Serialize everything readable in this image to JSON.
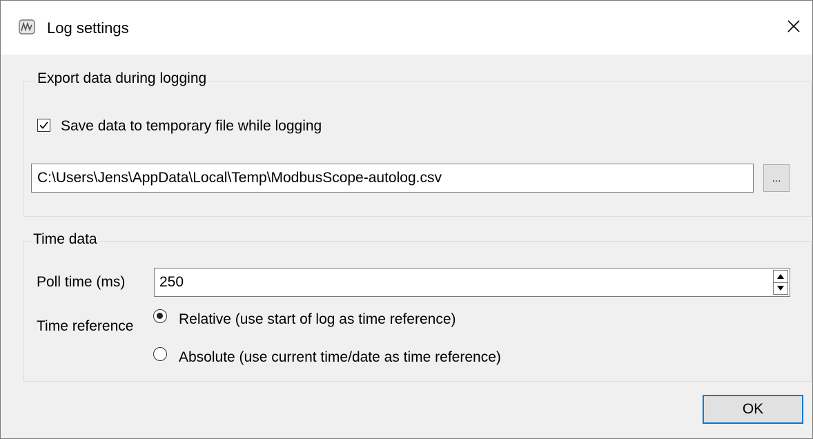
{
  "window": {
    "title": "Log settings",
    "icon": "modbusscope-app-icon",
    "close_icon": "close-icon"
  },
  "export_group": {
    "legend": "Export data during logging",
    "save_checkbox": {
      "label": "Save data to temporary file while logging",
      "checked": true
    },
    "file_path": "C:\\Users\\Jens\\AppData\\Local\\Temp\\ModbusScope-autolog.csv",
    "browse_label": "..."
  },
  "time_group": {
    "legend": "Time data",
    "poll_time_label": "Poll time (ms)",
    "poll_time_value": "250",
    "time_reference_label": "Time reference",
    "options": [
      {
        "label": "Relative (use start of log as time reference)",
        "selected": true
      },
      {
        "label": "Absolute (use current time/date as time reference)",
        "selected": false
      }
    ]
  },
  "buttons": {
    "ok_label": "OK"
  },
  "colors": {
    "accent": "#0078d7",
    "background": "#f0f0f0",
    "border": "#7a7a7a"
  }
}
